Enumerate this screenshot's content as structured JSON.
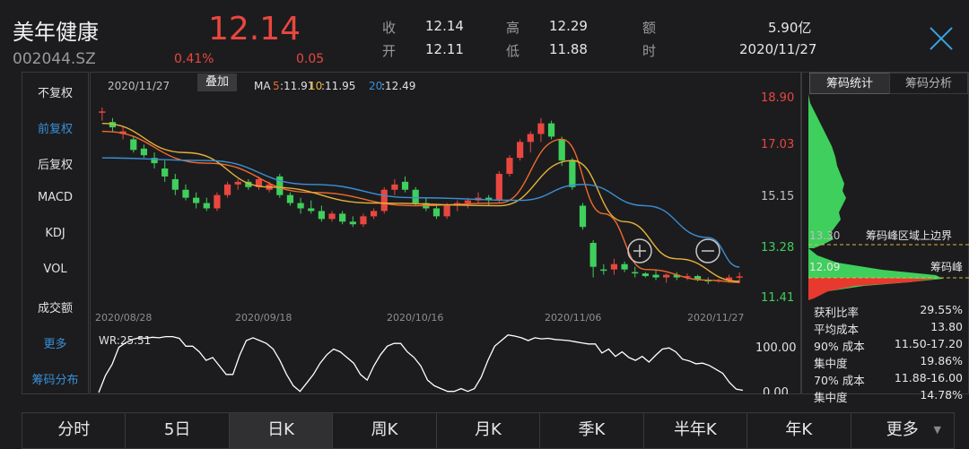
{
  "header": {
    "name": "美年健康",
    "code": "002044.SZ",
    "price": "12.14",
    "pct": "0.41%",
    "change": "0.05",
    "quotes": [
      {
        "label": "收",
        "value": "12.14"
      },
      {
        "label": "高",
        "value": "12.29"
      },
      {
        "label": "额",
        "value": "5.90亿"
      },
      {
        "label": "开",
        "value": "12.11"
      },
      {
        "label": "低",
        "value": "11.88"
      },
      {
        "label": "时",
        "value": "2020/11/27"
      }
    ]
  },
  "left_menu": [
    "不复权",
    "前复权",
    "后复权",
    "MACD",
    "KDJ",
    "VOL",
    "成交额",
    "更多",
    "筹码分布"
  ],
  "left_menu_active": "前复权",
  "chart_top": {
    "date": "2020/11/27",
    "overlay_btn": "叠加",
    "ma5_label": "MA",
    "ma5_num": "5",
    "ma5_val": ":11.91",
    "ma10_num": "10",
    "ma10_val": ":11.95",
    "ma20_num": "20",
    "ma20_val": ":12.49"
  },
  "y_axis": [
    "18.90",
    "17.03",
    "15.15",
    "13.28",
    "11.41"
  ],
  "x_axis": [
    "2020/08/28",
    "2020/09/18",
    "2020/10/16",
    "2020/11/06",
    "2020/11/27"
  ],
  "wr": {
    "label": "WR:25.51",
    "ticks": [
      "100.00",
      "0.00"
    ]
  },
  "colors": {
    "up": "#e8473f",
    "down": "#3fcf5c",
    "ma5": "#f06a2c",
    "ma10": "#e6b23a",
    "ma20": "#3a8fd6",
    "wr": "#ffffff",
    "accent": "#3aa3e3"
  },
  "chart_data": [
    {
      "type": "candlestick",
      "title": "",
      "x_range": [
        "2020/08/28",
        "2020/11/27"
      ],
      "ylim": [
        11.41,
        18.9
      ],
      "series": [
        {
          "name": "K",
          "ohlc": [
            [
              18.3,
              18.5,
              18.0,
              18.35
            ],
            [
              17.95,
              18.1,
              17.6,
              17.75
            ],
            [
              17.5,
              17.8,
              17.3,
              17.6
            ],
            [
              17.3,
              17.4,
              16.8,
              16.9
            ],
            [
              16.95,
              17.1,
              16.6,
              16.7
            ],
            [
              16.6,
              16.8,
              16.2,
              16.4
            ],
            [
              16.2,
              16.5,
              15.7,
              15.9
            ],
            [
              15.8,
              16.0,
              15.2,
              15.4
            ],
            [
              15.4,
              15.6,
              15.0,
              15.1
            ],
            [
              15.1,
              15.3,
              14.7,
              14.9
            ],
            [
              14.9,
              15.1,
              14.6,
              14.7
            ],
            [
              14.7,
              15.3,
              14.6,
              15.2
            ],
            [
              15.2,
              15.7,
              15.1,
              15.6
            ],
            [
              15.6,
              15.8,
              15.4,
              15.7
            ],
            [
              15.7,
              15.8,
              15.4,
              15.5
            ],
            [
              15.5,
              15.9,
              15.4,
              15.8
            ],
            [
              15.4,
              15.7,
              15.3,
              15.6
            ],
            [
              15.9,
              16.0,
              15.1,
              15.2
            ],
            [
              15.2,
              15.3,
              14.8,
              14.9
            ],
            [
              14.9,
              15.1,
              14.5,
              14.7
            ],
            [
              14.7,
              15.0,
              14.5,
              14.6
            ],
            [
              14.6,
              14.8,
              14.2,
              14.3
            ],
            [
              14.3,
              14.6,
              14.2,
              14.5
            ],
            [
              14.5,
              14.6,
              14.1,
              14.2
            ],
            [
              14.2,
              14.4,
              14.0,
              14.1
            ],
            [
              14.1,
              14.5,
              14.0,
              14.4
            ],
            [
              14.4,
              14.7,
              14.3,
              14.6
            ],
            [
              14.6,
              15.5,
              14.5,
              15.4
            ],
            [
              15.4,
              15.8,
              15.2,
              15.6
            ],
            [
              15.7,
              15.9,
              15.3,
              15.4
            ],
            [
              15.4,
              15.5,
              14.8,
              14.9
            ],
            [
              14.9,
              15.1,
              14.6,
              14.7
            ],
            [
              14.7,
              14.8,
              14.3,
              14.4
            ],
            [
              14.4,
              14.9,
              14.3,
              14.8
            ],
            [
              14.8,
              15.0,
              14.6,
              14.9
            ],
            [
              14.9,
              15.1,
              14.7,
              15.0
            ],
            [
              15.0,
              15.3,
              14.9,
              15.1
            ],
            [
              15.1,
              15.2,
              14.8,
              15.0
            ],
            [
              15.0,
              16.1,
              14.9,
              16.0
            ],
            [
              16.0,
              16.7,
              15.9,
              16.6
            ],
            [
              16.6,
              17.3,
              16.5,
              17.2
            ],
            [
              17.2,
              17.6,
              16.8,
              17.5
            ],
            [
              17.5,
              18.1,
              17.2,
              17.9
            ],
            [
              17.9,
              18.0,
              17.3,
              17.4
            ],
            [
              17.3,
              17.4,
              16.3,
              16.5
            ],
            [
              16.5,
              16.6,
              15.4,
              15.5
            ],
            [
              14.8,
              14.9,
              13.9,
              14.0
            ],
            [
              13.4,
              13.5,
              12.1,
              12.5
            ],
            [
              12.4,
              12.6,
              12.2,
              12.35
            ],
            [
              12.4,
              12.8,
              12.2,
              12.6
            ],
            [
              12.6,
              12.7,
              12.3,
              12.4
            ],
            [
              12.3,
              12.5,
              12.1,
              12.25
            ],
            [
              12.25,
              12.3,
              12.1,
              12.15
            ],
            [
              12.2,
              12.4,
              12.0,
              12.1
            ],
            [
              12.1,
              12.25,
              11.9,
              12.2
            ],
            [
              12.2,
              12.3,
              12.0,
              12.1
            ],
            [
              12.1,
              12.25,
              12.0,
              12.15
            ],
            [
              12.15,
              12.2,
              11.95,
              12.0
            ],
            [
              12.0,
              12.1,
              11.85,
              11.95
            ],
            [
              11.95,
              12.05,
              11.9,
              12.0
            ],
            [
              12.0,
              12.2,
              11.9,
              12.1
            ],
            [
              12.11,
              12.29,
              11.88,
              12.14
            ]
          ]
        },
        {
          "name": "MA5",
          "values": [
            [
              0,
              17.6
            ],
            [
              10,
              16.4
            ],
            [
              20,
              15.3
            ],
            [
              30,
              14.8
            ],
            [
              38,
              14.9
            ],
            [
              44,
              17.3
            ],
            [
              48,
              14.5
            ],
            [
              52,
              12.4
            ],
            [
              58,
              12.0
            ],
            [
              61,
              11.91
            ]
          ]
        },
        {
          "name": "MA10",
          "values": [
            [
              0,
              17.9
            ],
            [
              8,
              16.8
            ],
            [
              16,
              15.5
            ],
            [
              26,
              14.9
            ],
            [
              38,
              14.8
            ],
            [
              45,
              16.5
            ],
            [
              50,
              14.2
            ],
            [
              55,
              12.8
            ],
            [
              61,
              11.95
            ]
          ]
        },
        {
          "name": "MA20",
          "values": [
            [
              0,
              16.6
            ],
            [
              10,
              16.5
            ],
            [
              20,
              15.6
            ],
            [
              30,
              15.1
            ],
            [
              40,
              15.0
            ],
            [
              46,
              15.6
            ],
            [
              52,
              14.8
            ],
            [
              58,
              13.6
            ],
            [
              61,
              12.49
            ]
          ]
        }
      ]
    },
    {
      "type": "line",
      "title": "",
      "ylim": [
        0,
        100
      ],
      "series": [
        {
          "name": "WR",
          "values": [
            0,
            30,
            50,
            80,
            88,
            94,
            97,
            96,
            98,
            97,
            99,
            99,
            96,
            82,
            82,
            72,
            57,
            62,
            47,
            32,
            32,
            66,
            92,
            97,
            92,
            87,
            77,
            57,
            32,
            12,
            2,
            17,
            32,
            52,
            67,
            77,
            72,
            62,
            52,
            32,
            22,
            47,
            67,
            82,
            87,
            87,
            72,
            62,
            47,
            22,
            12,
            7,
            2,
            2,
            7,
            2,
            7,
            27,
            57,
            82,
            92,
            102,
            100,
            97,
            92,
            97,
            95,
            96,
            94,
            93,
            92,
            90,
            88,
            86,
            86,
            70,
            77,
            64,
            72,
            62,
            57,
            64,
            54,
            66,
            77,
            79,
            72,
            59,
            56,
            51,
            52,
            48,
            41,
            34,
            18,
            6,
            4
          ]
        }
      ]
    }
  ],
  "right_panel": {
    "tabs": [
      "筹码统计",
      "筹码分析"
    ],
    "marks": {
      "upper_val": "13.30",
      "upper_label": "筹码峰区域上边界",
      "peak_val": "12.09",
      "peak_label": "筹码峰"
    },
    "stats": [
      [
        "获利比率",
        "29.55%"
      ],
      [
        "平均成本",
        "13.80"
      ],
      [
        "90% 成本",
        "11.50-17.20"
      ],
      [
        "集中度",
        "19.86%"
      ],
      [
        "70% 成本",
        "11.88-16.00"
      ],
      [
        "集中度",
        "14.78%"
      ]
    ]
  },
  "bottom_tabs": [
    "分时",
    "5日",
    "日K",
    "周K",
    "月K",
    "季K",
    "半年K",
    "年K",
    "更多"
  ],
  "bottom_active": "日K"
}
